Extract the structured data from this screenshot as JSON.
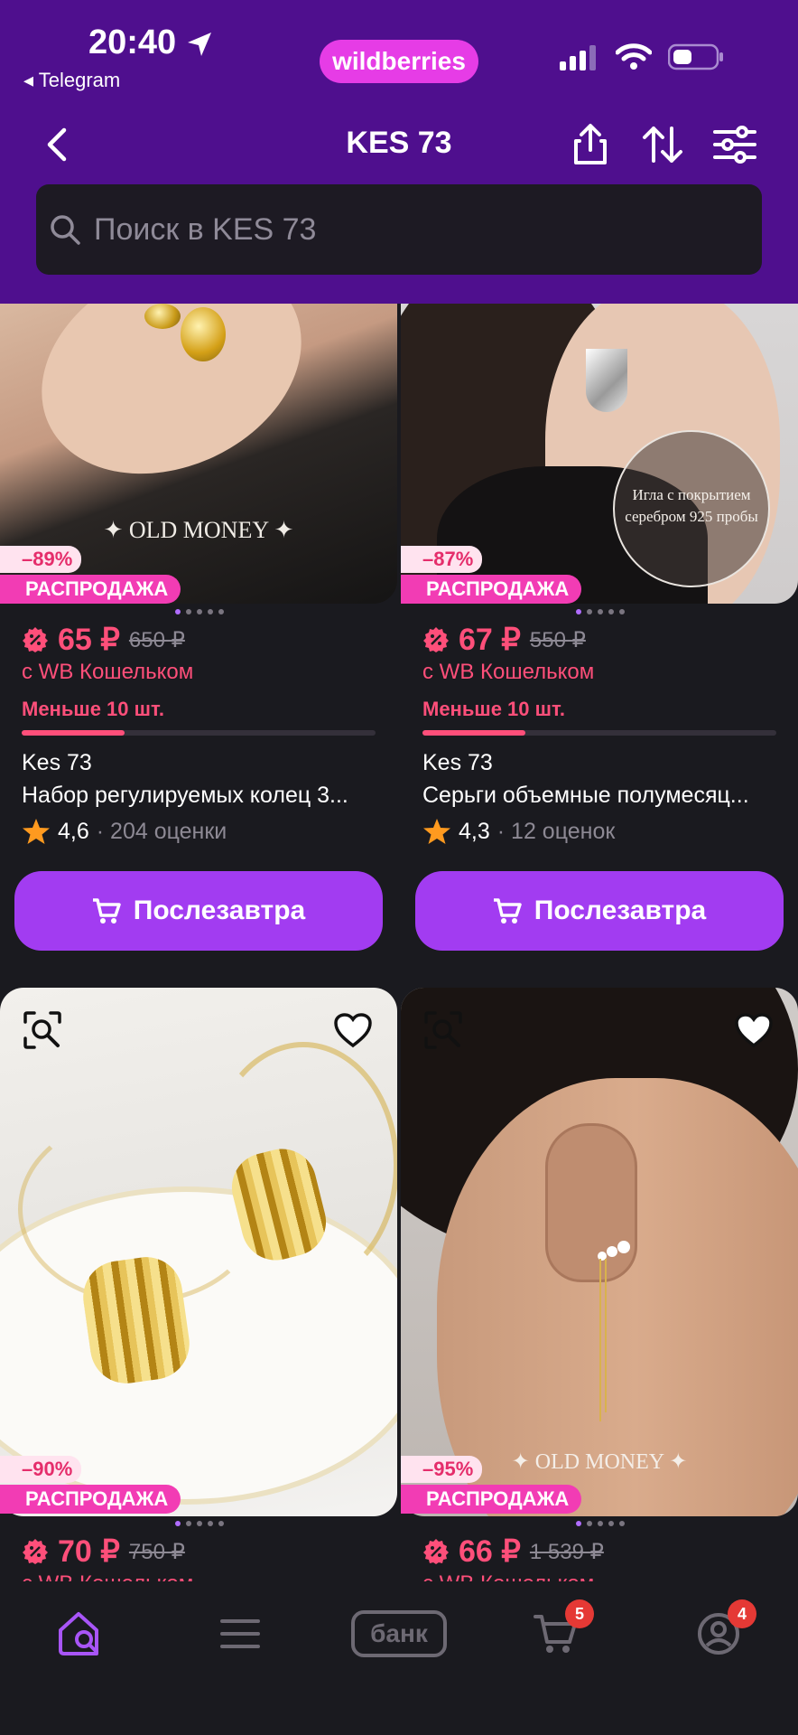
{
  "status": {
    "time": "20:40",
    "back_app": "◂ Telegram",
    "brand": "wildberries"
  },
  "nav": {
    "title": "KES 73"
  },
  "search": {
    "placeholder": "Поиск в KES 73"
  },
  "products": [
    {
      "discount": "–89%",
      "sale_label": "РАСПРОДАЖА",
      "price": "65 ₽",
      "old_price": "650 ₽",
      "wallet": "с WB Кошельком",
      "stock": "Меньше 10 шт.",
      "stock_level": 0.29,
      "brand": "Kes 73",
      "title": "Набор регулируемых колец 3...",
      "rating": "4,6",
      "reviews": "· 204 оценки",
      "button": "Послезавтра",
      "image_caption": "✦ OLD MONEY ✦"
    },
    {
      "discount": "–87%",
      "sale_label": "РАСПРОДАЖА",
      "price": "67 ₽",
      "old_price": "550 ₽",
      "wallet": "с WB Кошельком",
      "stock": "Меньше 10 шт.",
      "stock_level": 0.29,
      "brand": "Kes 73",
      "title": "Серьги объемные полумесяц...",
      "rating": "4,3",
      "reviews": "· 12 оценок",
      "button": "Послезавтра",
      "image_caption": "Игла с покрытием серебром 925 пробы"
    },
    {
      "discount": "–90%",
      "sale_label": "РАСПРОДАЖА",
      "price": "70 ₽",
      "old_price": "750 ₽",
      "wallet": "с WB Кошельком"
    },
    {
      "discount": "–95%",
      "sale_label": "РАСПРОДАЖА",
      "price": "66 ₽",
      "old_price": "1 539 ₽",
      "wallet": "с WB Кошельком",
      "image_caption": "✦ OLD MONEY ✦"
    }
  ],
  "tabbar": {
    "bank_label": "банк",
    "cart_badge": "5",
    "profile_badge": "4"
  },
  "colors": {
    "header": "#4f0f8e",
    "accent": "#a23cf1",
    "price": "#ff4f7a",
    "sale": "#f23cb4"
  }
}
